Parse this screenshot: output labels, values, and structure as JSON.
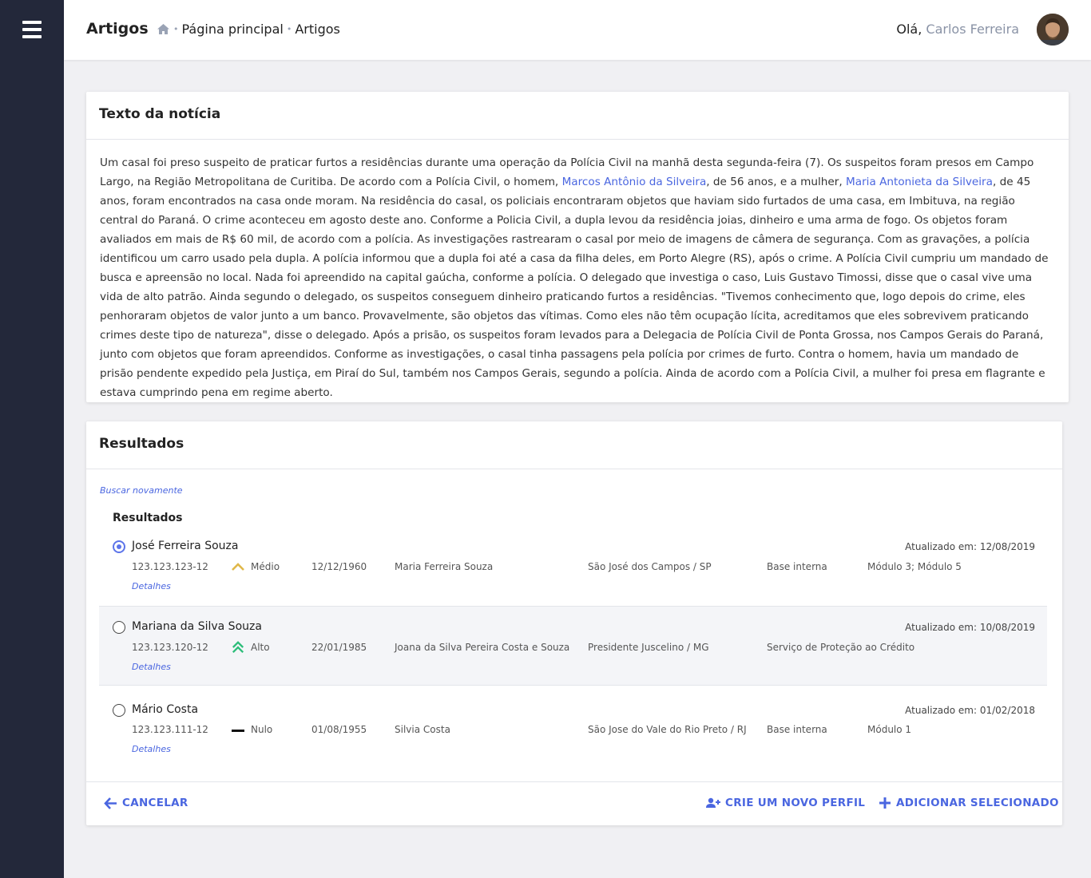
{
  "header": {
    "title": "Artigos",
    "breadcrumb": [
      "Página principal",
      "Artigos"
    ],
    "greeting": "Olá,",
    "user_name": "Carlos Ferreira"
  },
  "news": {
    "title": "Texto da notícia",
    "text_parts": [
      "Um casal foi preso suspeito de praticar furtos a residências durante uma operação da Polícia Civil na manhã desta segunda-feira (7). Os suspeitos foram presos em Campo Largo, na Região Metropolitana de Curitiba. De acordo com a Polícia Civil, o homem, ",
      "Marcos Antônio da Silveira",
      ", de 56 anos, e a mulher, ",
      "Maria Antonieta da Silveira",
      ", de 45 anos, foram encontrados na casa onde moram. Na residência do casal, os policiais encontraram objetos que haviam sido furtados de uma casa, em Imbituva, na região central do Paraná. O crime aconteceu em agosto deste ano. Conforme a Policia Civil, a dupla levou da residência joias, dinheiro e uma arma de fogo. Os objetos foram avaliados em mais de R$ 60 mil, de acordo com a polícia. As investigações rastrearam o casal por meio de imagens de câmera de segurança. Com as gravações, a polícia identificou um carro usado pela dupla. A polícia informou que a dupla foi até a casa da filha deles, em Porto Alegre (RS), após o crime. A Polícia Civil cumpriu um mandado de busca e apreensão no local. Nada foi apreendido na capital gaúcha, conforme a polícia. O delegado que investiga o caso, Luis Gustavo Timossi, disse que o casal vive uma vida de alto patrão. Ainda segundo o delegado, os suspeitos conseguem dinheiro praticando furtos a residências. \"Tivemos conhecimento que, logo depois do crime, eles penhoraram objetos de valor junto a um banco. Provavelmente, são objetos das vítimas. Como eles não têm ocupação lícita, acreditamos que eles sobrevivem praticando crimes deste tipo de natureza\", disse o delegado. Após a prisão, os suspeitos foram levados para a Delegacia de Polícia Civil de Ponta Grossa, nos Campos Gerais do Paraná, junto com objetos que foram apreendidos. Conforme as investigações, o casal tinha passagens pela polícia por crimes de furto. Contra o homem, havia um mandado de prisão pendente expedido pela Justiça, em Piraí do Sul, também nos Campos Gerais, segundo a polícia. Ainda de acordo com a Polícia Civil, a mulher foi presa em flagrante e estava cumprindo pena em regime aberto."
    ]
  },
  "results": {
    "title": "Resultados",
    "search_again": "Buscar novamente",
    "subtitle": "Resultados",
    "items": [
      {
        "name": "José Ferreira Souza",
        "updated": "Atualizado em: 12/08/2019",
        "document": "123.123.123-12",
        "risk": "Médio",
        "risk_color": "#e0b84a",
        "birth": "12/12/1960",
        "mother": "Maria Ferreira Souza",
        "city": "São José dos Campos / SP",
        "source": "Base interna",
        "modules": "Módulo 3; Módulo 5",
        "details": "Detalhes",
        "selected": true
      },
      {
        "name": "Mariana da Silva Souza",
        "updated": "Atualizado em: 10/08/2019",
        "document": "123.123.120-12",
        "risk": "Alto",
        "risk_color": "#2dbd7a",
        "birth": "22/01/1985",
        "mother": "Joana da Silva Pereira Costa e Souza",
        "city": "Presidente Juscelino / MG",
        "source": "Serviço de Proteção ao Crédito",
        "modules": "",
        "details": "Detalhes",
        "selected": false
      },
      {
        "name": "Mário Costa",
        "updated": "Atualizado em: 01/02/2018",
        "document": "123.123.111-12",
        "risk": "Nulo",
        "risk_color": "#111111",
        "birth": "01/08/1955",
        "mother": "Silvia Costa",
        "city": "São Jose do Vale do Rio Preto / RJ",
        "source": "Base interna",
        "modules": "Módulo 1",
        "details": "Detalhes",
        "selected": false
      }
    ]
  },
  "footer": {
    "cancel": "CANCELAR",
    "new_profile": "CRIE UM NOVO PERFIL",
    "add_selected": "ADICIONAR SELECIONADO"
  },
  "colors": {
    "sidebar": "#23283a",
    "accent": "#4a66e0",
    "background": "#f0f0f3"
  }
}
